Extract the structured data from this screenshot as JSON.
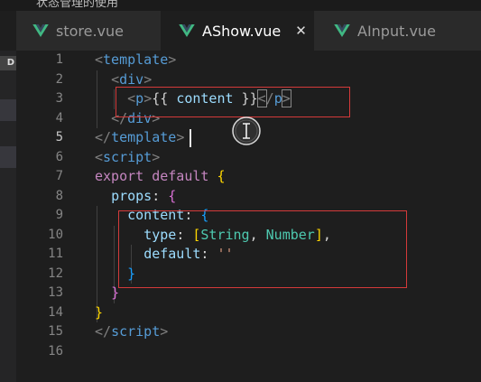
{
  "tabs": [
    {
      "label": "store.vue",
      "active": false
    },
    {
      "label": "AShow.vue",
      "active": true
    },
    {
      "label": "AInput.vue",
      "active": false
    }
  ],
  "close_glyph": "✕",
  "sidebar_label": "D",
  "top_text": "状态管理的使用",
  "colors": {
    "vue_icon_green": "#41b883",
    "vue_icon_dark": "#35495e",
    "highlight_box": "#d43a3a"
  },
  "editor": {
    "line_numbers": [
      "1",
      "2",
      "3",
      "4",
      "5",
      "6",
      "7",
      "8",
      "9",
      "10",
      "11",
      "12",
      "13",
      "14",
      "15",
      "16"
    ],
    "current_line": "5",
    "lines": [
      [
        [
          "t-br",
          "<"
        ],
        [
          "t-tag",
          "template"
        ],
        [
          "t-br",
          ">"
        ]
      ],
      [
        [
          "t-plain",
          "  "
        ],
        [
          "t-br",
          "<"
        ],
        [
          "t-tag",
          "div"
        ],
        [
          "t-br",
          ">"
        ]
      ],
      [
        [
          "t-plain",
          "    "
        ],
        [
          "t-br",
          "<"
        ],
        [
          "t-tag",
          "p"
        ],
        [
          "t-br",
          ">"
        ],
        [
          "t-plain",
          "{{ "
        ],
        [
          "t-prop",
          "content"
        ],
        [
          "t-plain",
          " }}"
        ],
        [
          "t-br bm",
          "<"
        ],
        [
          "t-br",
          "/"
        ],
        [
          "t-tag",
          "p"
        ],
        [
          "t-br bm",
          ">"
        ]
      ],
      [
        [
          "t-plain",
          "  "
        ],
        [
          "t-br",
          "</"
        ],
        [
          "t-tag",
          "div"
        ],
        [
          "t-br",
          ">"
        ]
      ],
      [
        [
          "t-br",
          "</"
        ],
        [
          "t-tag",
          "template"
        ],
        [
          "t-br",
          ">"
        ]
      ],
      [
        [
          "t-br",
          "<"
        ],
        [
          "t-tag",
          "script"
        ],
        [
          "t-br",
          ">"
        ]
      ],
      [
        [
          "t-kw",
          "export"
        ],
        [
          "t-plain",
          " "
        ],
        [
          "t-kw",
          "default"
        ],
        [
          "t-plain",
          " "
        ],
        [
          "t-bk1",
          "{"
        ]
      ],
      [
        [
          "t-plain",
          "  "
        ],
        [
          "t-prop",
          "props"
        ],
        [
          "t-plain",
          ": "
        ],
        [
          "t-bk2",
          "{"
        ]
      ],
      [
        [
          "t-plain",
          "    "
        ],
        [
          "t-prop",
          "content"
        ],
        [
          "t-plain",
          ": "
        ],
        [
          "t-bk3",
          "{"
        ]
      ],
      [
        [
          "t-plain",
          "      "
        ],
        [
          "t-prop",
          "type"
        ],
        [
          "t-plain",
          ": "
        ],
        [
          "t-bk1",
          "["
        ],
        [
          "t-type",
          "String"
        ],
        [
          "t-plain",
          ", "
        ],
        [
          "t-type",
          "Number"
        ],
        [
          "t-bk1",
          "]"
        ],
        [
          "t-plain",
          ","
        ]
      ],
      [
        [
          "t-plain",
          "      "
        ],
        [
          "t-prop",
          "default"
        ],
        [
          "t-plain",
          ": "
        ],
        [
          "t-str",
          "''"
        ]
      ],
      [
        [
          "t-plain",
          "    "
        ],
        [
          "t-bk3",
          "}"
        ]
      ],
      [
        [
          "t-plain",
          "  "
        ],
        [
          "t-bk2",
          "}"
        ]
      ],
      [
        [
          "t-bk1",
          "}"
        ]
      ],
      [
        [
          "t-br",
          "</"
        ],
        [
          "t-tag",
          "script"
        ],
        [
          "t-br",
          ">"
        ]
      ],
      []
    ]
  }
}
